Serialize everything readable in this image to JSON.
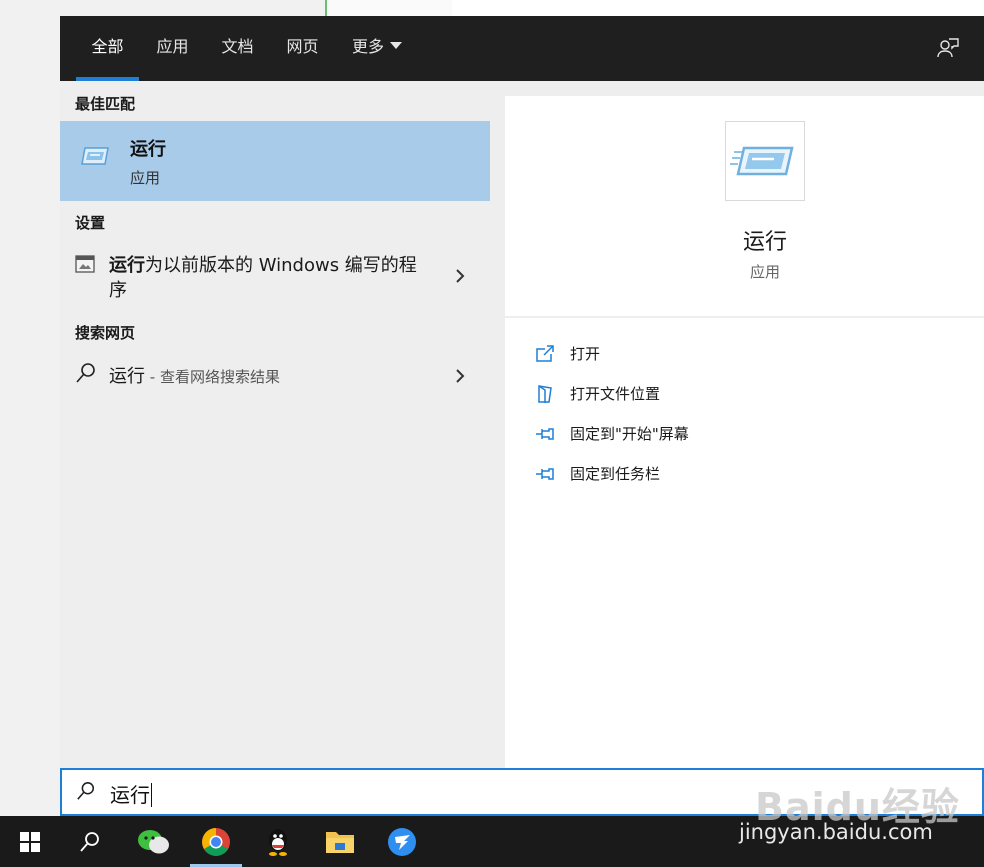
{
  "tabs": [
    {
      "label": "全部"
    },
    {
      "label": "应用"
    },
    {
      "label": "文档"
    },
    {
      "label": "网页"
    },
    {
      "label": "更多"
    }
  ],
  "left": {
    "best_match_header": "最佳匹配",
    "best_match": {
      "title": "运行",
      "subtitle": "应用",
      "icon": "run-app-icon"
    },
    "settings_header": "设置",
    "setting_item": {
      "bold": "运行",
      "rest": "为以前版本的 Windows 编写的程序",
      "icon": "legacy-program-icon"
    },
    "web_header": "搜索网页",
    "web_item": {
      "query": "运行",
      "suffix": " - 查看网络搜索结果",
      "icon": "search-icon"
    }
  },
  "right": {
    "app_name": "运行",
    "app_type": "应用",
    "actions": [
      {
        "label": "打开",
        "icon": "open-icon"
      },
      {
        "label": "打开文件位置",
        "icon": "file-location-icon"
      },
      {
        "label": "固定到\"开始\"屏幕",
        "icon": "pin-icon"
      },
      {
        "label": "固定到任务栏",
        "icon": "pin-icon"
      }
    ]
  },
  "search": {
    "value": "运行"
  },
  "taskbar": {
    "items": [
      "windows-start-icon",
      "search-icon",
      "wechat-icon",
      "chrome-icon",
      "qq-icon",
      "file-explorer-icon",
      "dingtalk-icon"
    ]
  },
  "watermark": {
    "line1": "Baidu经验",
    "line2": "jingyan.baidu.com"
  },
  "colors": {
    "accent": "#1e7fd6",
    "selection": "#a7cbe9",
    "topbar": "#1f1f1f",
    "taskbar": "#1a1a1a"
  }
}
